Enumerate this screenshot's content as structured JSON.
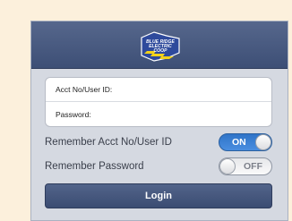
{
  "header": {
    "logo_icon": "blue-ridge-electric-coop-logo",
    "logo_text_line1": "BLUE RIDGE",
    "logo_text_line2": "ELECTRIC COOP"
  },
  "form": {
    "acct_label": "Acct No/User ID:",
    "acct_value": "",
    "password_label": "Password:",
    "password_value": ""
  },
  "toggles": {
    "remember_acct_label": "Remember Acct No/User ID",
    "remember_acct_state": "ON",
    "remember_password_label": "Remember Password",
    "remember_password_state": "OFF"
  },
  "login_button": {
    "label": "Login"
  },
  "colors": {
    "page_background": "#fcf0dc",
    "header": "#4a5b80",
    "switch_on": "#2f74c8",
    "logo_yellow": "#f3d21a"
  }
}
